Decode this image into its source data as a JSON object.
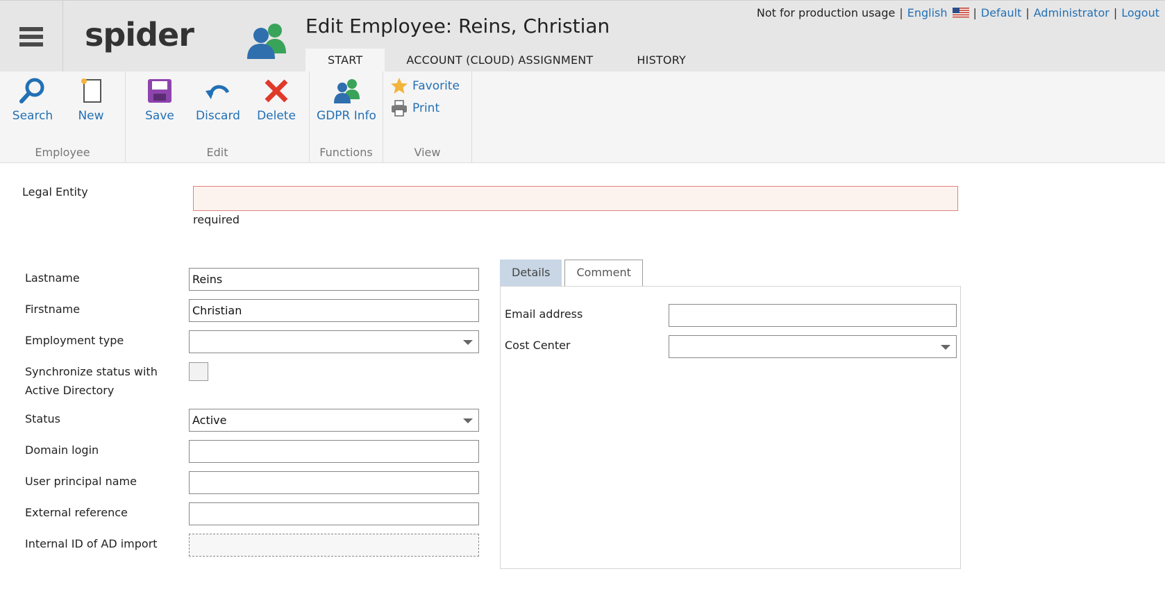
{
  "header": {
    "logo_text": "spider",
    "title": "Edit Employee: Reins, Christian",
    "notice": "Not for production usage",
    "language_link": "English",
    "default_link": "Default",
    "user_link": "Administrator",
    "logout_link": "Logout",
    "separator": "|",
    "tabs": [
      "START",
      "ACCOUNT (CLOUD) ASSIGNMENT",
      "HISTORY"
    ]
  },
  "ribbon": {
    "groups": {
      "employee": "Employee",
      "edit": "Edit",
      "functions": "Functions",
      "view": "View"
    },
    "buttons": {
      "search": "Search",
      "new": "New",
      "save": "Save",
      "discard": "Discard",
      "delete": "Delete",
      "gdpr": "GDPR Info",
      "favorite": "Favorite",
      "print": "Print"
    }
  },
  "form": {
    "legal_entity": {
      "label": "Legal Entity",
      "value": "",
      "hint": "required"
    },
    "lastname": {
      "label": "Lastname",
      "value": "Reins"
    },
    "firstname": {
      "label": "Firstname",
      "value": "Christian"
    },
    "employment_type": {
      "label": "Employment type",
      "value": ""
    },
    "sync_status": {
      "label_line1": "Synchronize status with",
      "label_line2": "Active Directory",
      "checked": false
    },
    "status": {
      "label": "Status",
      "value": "Active"
    },
    "domain_login": {
      "label": "Domain login",
      "value": ""
    },
    "upn": {
      "label": "User principal name",
      "value": ""
    },
    "external_reference": {
      "label": "External reference",
      "value": ""
    },
    "internal_id": {
      "label": "Internal ID of AD import",
      "value": ""
    }
  },
  "details": {
    "tabs": [
      "Details",
      "Comment"
    ],
    "email": {
      "label": "Email address",
      "value": ""
    },
    "cost_center": {
      "label": "Cost Center",
      "value": ""
    }
  },
  "colors": {
    "link": "#2270b5",
    "header_bg": "#e6e6e6",
    "ribbon_bg": "#f5f5f5",
    "error_border": "#e2807c",
    "error_bg": "#fdf3ee",
    "active_tab": "#c8d6e5"
  },
  "icons": {
    "menu": "hamburger-icon",
    "title": "employees-icon",
    "flag": "us-flag-icon",
    "search": "magnifier-icon",
    "new": "new-document-icon",
    "save": "floppy-disk-icon",
    "discard": "undo-icon",
    "delete": "red-x-icon",
    "gdpr": "people-icon",
    "favorite": "star-icon",
    "print": "printer-icon"
  }
}
